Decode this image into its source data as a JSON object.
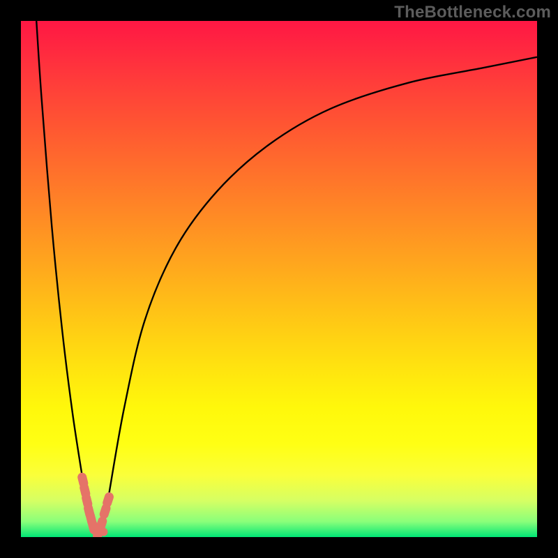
{
  "watermark": "TheBottleneck.com",
  "chart_data": {
    "type": "line",
    "title": "",
    "xlabel": "",
    "ylabel": "",
    "xlim": [
      0,
      100
    ],
    "ylim": [
      0,
      100
    ],
    "grid": false,
    "legend": false,
    "series": [
      {
        "name": "bottleneck-curve",
        "x": [
          3,
          4,
          6,
          8,
          10,
          12,
          13,
          14,
          15,
          16,
          17,
          20,
          24,
          30,
          38,
          48,
          60,
          75,
          90,
          100
        ],
        "y": [
          100,
          85,
          60,
          40,
          24,
          11,
          5,
          1,
          0,
          2,
          8,
          25,
          42,
          56,
          67,
          76,
          83,
          88,
          91,
          93
        ]
      }
    ],
    "markers": [
      {
        "name": "left-dash-cluster",
        "values": [
          {
            "x": 12.0,
            "y": 11.0
          },
          {
            "x": 12.4,
            "y": 9.0
          },
          {
            "x": 12.8,
            "y": 7.0
          },
          {
            "x": 13.2,
            "y": 5.0
          },
          {
            "x": 13.6,
            "y": 3.5
          },
          {
            "x": 14.0,
            "y": 2.0
          }
        ]
      },
      {
        "name": "right-dash-cluster",
        "values": [
          {
            "x": 15.0,
            "y": 0.8
          },
          {
            "x": 15.6,
            "y": 2.5
          },
          {
            "x": 16.3,
            "y": 5.0
          },
          {
            "x": 16.9,
            "y": 7.2
          }
        ]
      },
      {
        "name": "isolated-dot",
        "values": [
          {
            "x": 16.0,
            "y": 1.0
          }
        ]
      }
    ],
    "background_gradient": {
      "top": "#ff1744",
      "mid": "#ffeb3b",
      "bottom": "#00e676"
    }
  }
}
